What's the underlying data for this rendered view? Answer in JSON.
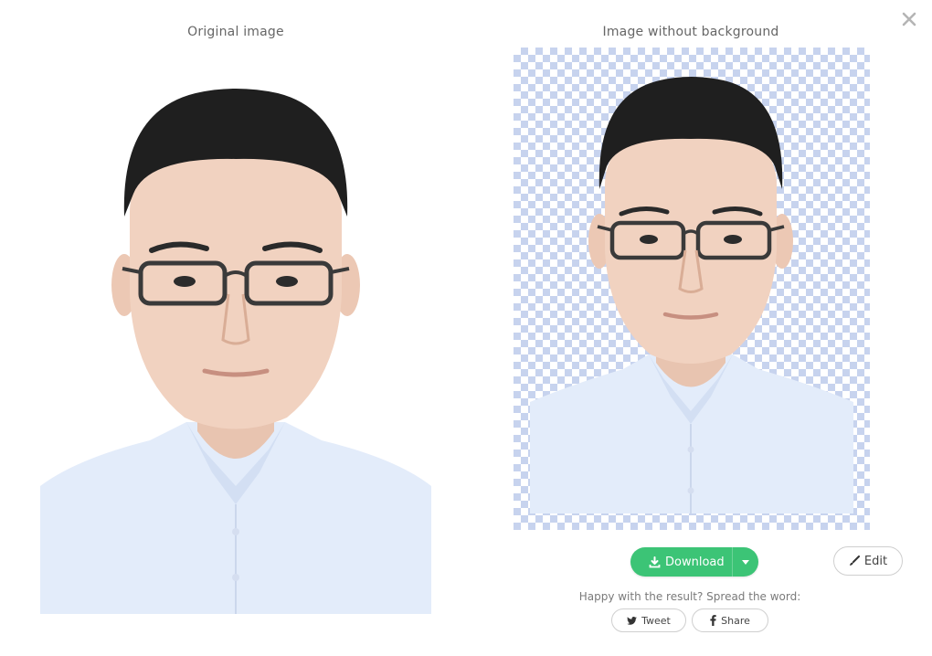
{
  "dialog": {
    "close_icon": "close-icon",
    "close_glyph": "✕"
  },
  "original": {
    "heading": "Original image"
  },
  "result": {
    "heading": "Image without background"
  },
  "actions": {
    "download_label": "Download",
    "download_icon": "download-icon",
    "dropdown_icon": "caret-down-icon",
    "edit_label": "Edit",
    "edit_icon": "brush-icon"
  },
  "share": {
    "prompt": "Happy with the result? Spread the word:",
    "tweet_label": "Tweet",
    "tweet_icon": "twitter-icon",
    "share_label": "Share",
    "share_icon": "facebook-icon"
  },
  "colors": {
    "accent": "#3cc476",
    "checker": "#c7d3ee",
    "shirt": "#e3ecfa",
    "skin": "#f1d2c0",
    "hair": "#1f1f1f"
  }
}
